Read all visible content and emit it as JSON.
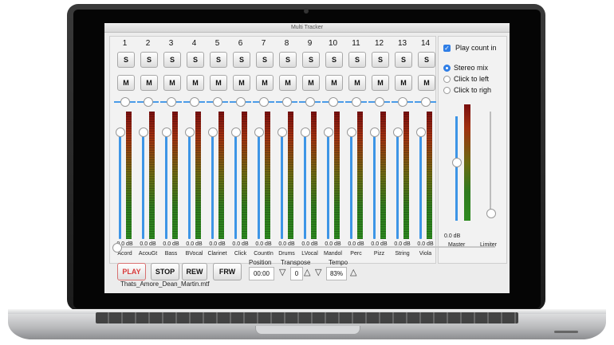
{
  "window": {
    "title": "Multi Tracker"
  },
  "channels": [
    {
      "number": "1",
      "name": "Acord",
      "db": "0.0 dB"
    },
    {
      "number": "2",
      "name": "AcouGt",
      "db": "0.0 dB"
    },
    {
      "number": "3",
      "name": "Bass",
      "db": "0.0 dB"
    },
    {
      "number": "4",
      "name": "BVocal",
      "db": "0.0 dB"
    },
    {
      "number": "5",
      "name": "Clarinet",
      "db": "0.0 dB"
    },
    {
      "number": "6",
      "name": "Click",
      "db": "0.0 dB"
    },
    {
      "number": "7",
      "name": "CountIn",
      "db": "0.0 dB"
    },
    {
      "number": "8",
      "name": "Drums",
      "db": "0.0 dB"
    },
    {
      "number": "9",
      "name": "LVocal",
      "db": "0.0 dB"
    },
    {
      "number": "10",
      "name": "Mandol",
      "db": "0.0 dB"
    },
    {
      "number": "11",
      "name": "Perc",
      "db": "0.0 dB"
    },
    {
      "number": "12",
      "name": "Pizz",
      "db": "0.0 dB"
    },
    {
      "number": "13",
      "name": "String",
      "db": "0.0 dB"
    },
    {
      "number": "14",
      "name": "Viola",
      "db": "0.0 dB"
    }
  ],
  "buttons": {
    "solo": "S",
    "mute": "M"
  },
  "side": {
    "play_count_in": "Play count in",
    "stereo_mix": "Stereo mix",
    "click_left": "Click to left",
    "click_right": "Click to righ",
    "master_db": "0.0 dB",
    "master_label": "Master",
    "limiter_label": "Limiter"
  },
  "transport": {
    "play": "PLAY",
    "stop": "STOP",
    "rew": "REW",
    "frw": "FRW",
    "position_label": "Position",
    "position_value": "00:00",
    "transpose_label": "Transpose",
    "transpose_value": "0",
    "tempo_label": "Tempo",
    "tempo_value": "83%",
    "file_name": "Thats_Amore_Dean_Martin.mtf",
    "down_arrow": "▽",
    "up_arrow": "△"
  },
  "colors": {
    "accent": "#2f7ee6",
    "play_text": "#d83a3a"
  }
}
